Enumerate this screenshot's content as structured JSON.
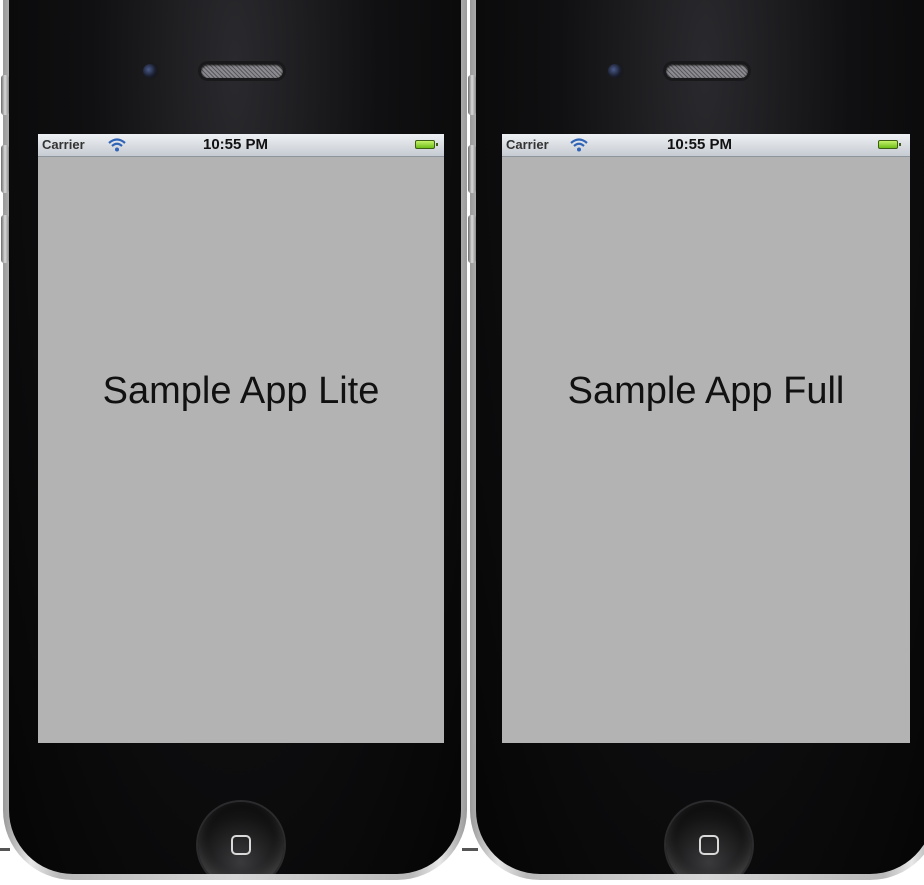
{
  "devices": [
    {
      "status_bar": {
        "carrier": "Carrier",
        "time": "10:55 PM"
      },
      "app_label": "Sample App Lite"
    },
    {
      "status_bar": {
        "carrier": "Carrier",
        "time": "10:55 PM"
      },
      "app_label": "Sample App Full"
    }
  ],
  "icons": {
    "wifi": "wifi-icon",
    "battery": "battery-icon",
    "home_button": "home-button-icon",
    "camera": "front-camera-icon",
    "speaker": "earpiece-speaker-icon"
  },
  "colors": {
    "screen_background": "#b3b3b3",
    "status_bar": "#d8dce1",
    "phone_body": "#0b0b0c",
    "bezel": "#c8c8c8",
    "battery": "#7fd12a",
    "wifi": "#2f64b7"
  }
}
